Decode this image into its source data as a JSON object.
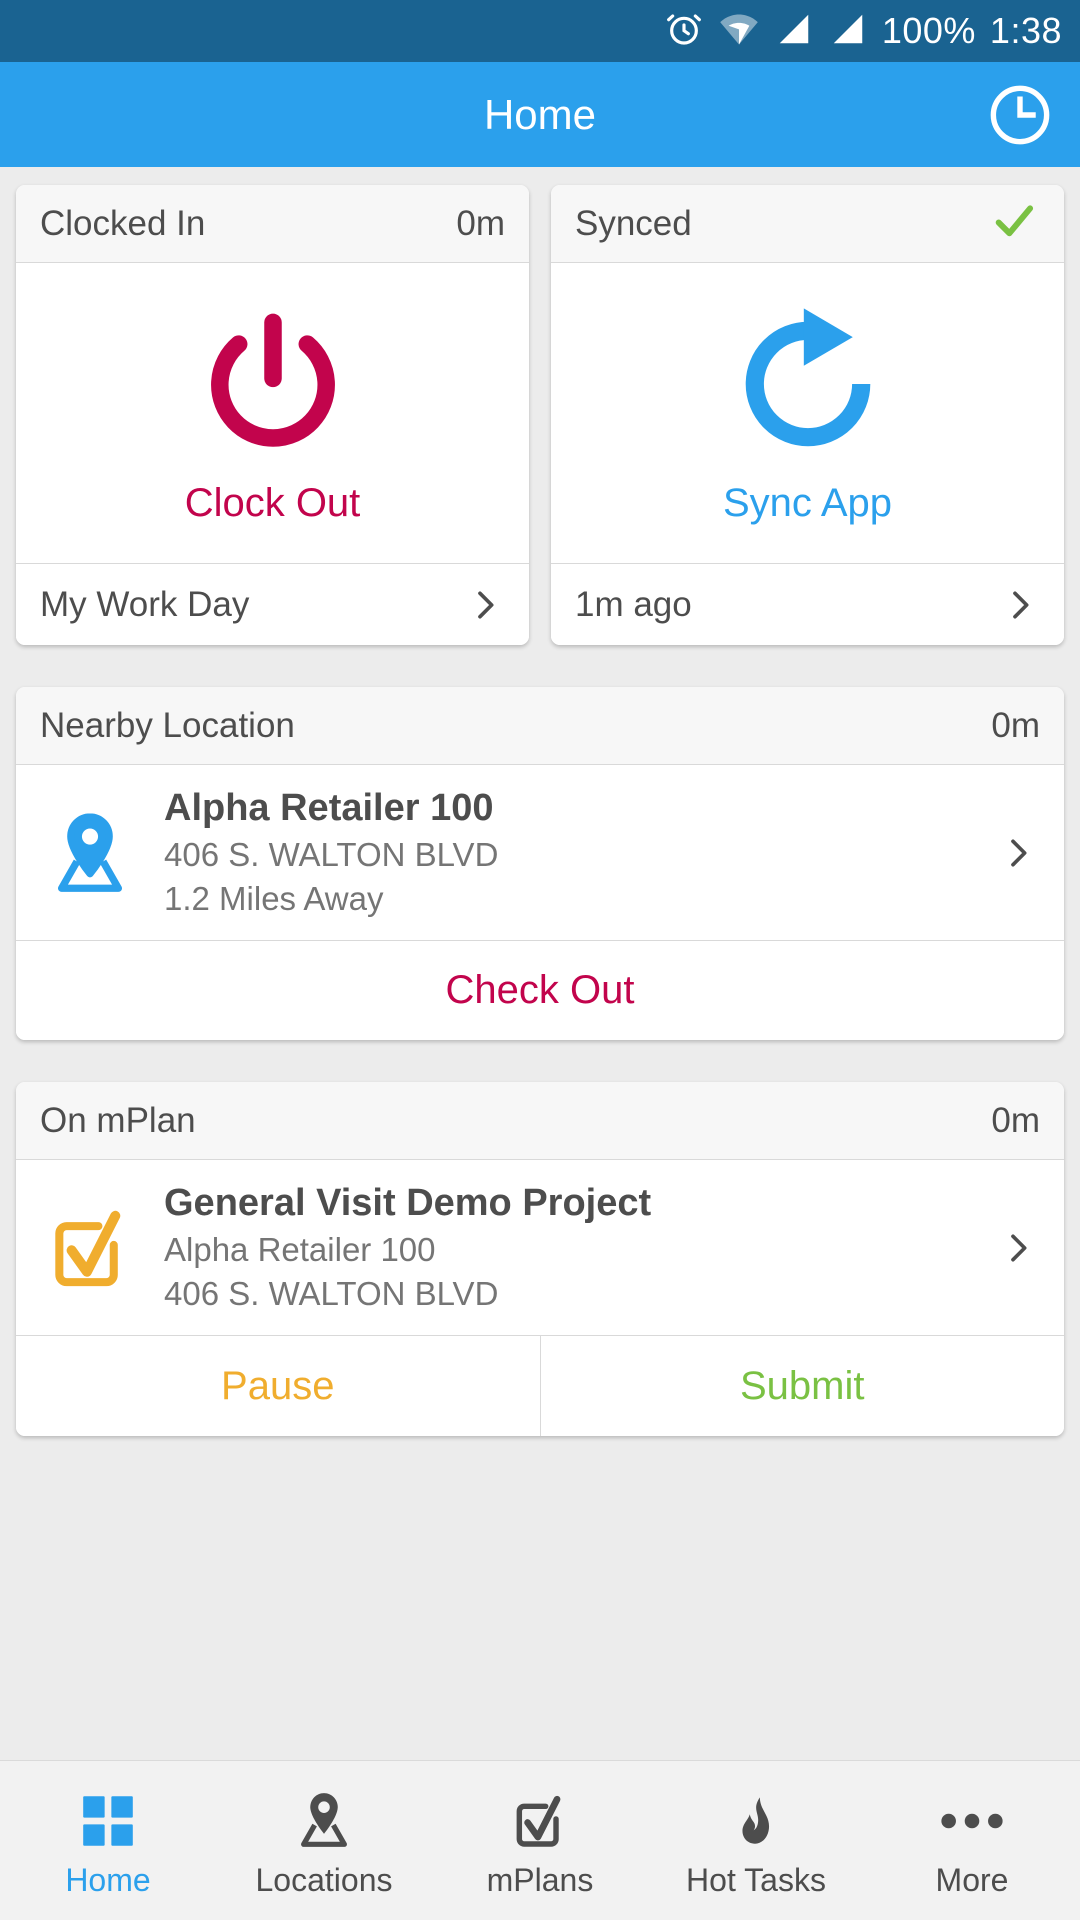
{
  "status_bar": {
    "icons": [
      "alarm-icon",
      "wifi-icon",
      "signal-1-icon",
      "signal-2-icon"
    ],
    "battery_percent": "100%",
    "time": "1:38"
  },
  "app_bar": {
    "title": "Home",
    "action_icon": "clock-icon"
  },
  "colors": {
    "status_bar_bg": "#1a6391",
    "app_bar_bg": "#2ba0ec",
    "accent_blue": "#2ba0ec",
    "crimson": "#c2044c",
    "amber": "#f0ad2e",
    "green": "#7ac143",
    "check_green": "#7ac143",
    "page_bg": "#ececec",
    "card_header_bg": "#f7f7f7",
    "text_primary": "#4d4d4d",
    "text_secondary": "#757575"
  },
  "clock_card": {
    "header_title": "Clocked In",
    "header_value": "0m",
    "action_icon": "power-icon",
    "action_label": "Clock Out",
    "footer_label": "My Work Day",
    "footer_icon": "chevron-right-icon"
  },
  "sync_card": {
    "header_title": "Synced",
    "header_status_icon": "check-icon",
    "action_icon": "refresh-icon",
    "action_label": "Sync App",
    "footer_label": "1m ago",
    "footer_icon": "chevron-right-icon"
  },
  "nearby_location_card": {
    "header_title": "Nearby Location",
    "header_value": "0m",
    "row_icon": "map-pin-icon",
    "name": "Alpha Retailer 100",
    "address": "406 S. WALTON BLVD",
    "distance": "1.2 Miles Away",
    "row_chevron": "chevron-right-icon",
    "action_label": "Check Out"
  },
  "mplan_card": {
    "header_title": "On mPlan",
    "header_value": "0m",
    "row_icon": "checkbox-checked-icon",
    "name": "General Visit Demo Project",
    "retailer": "Alpha Retailer 100",
    "address": "406 S. WALTON BLVD",
    "row_chevron": "chevron-right-icon",
    "pause_label": "Pause",
    "submit_label": "Submit"
  },
  "bottom_nav": {
    "items": [
      {
        "label": "Home",
        "icon": "grid-icon",
        "active": true
      },
      {
        "label": "Locations",
        "icon": "map-pin-icon",
        "active": false
      },
      {
        "label": "mPlans",
        "icon": "checkbox-checked-icon",
        "active": false
      },
      {
        "label": "Hot Tasks",
        "icon": "flame-icon",
        "active": false
      },
      {
        "label": "More",
        "icon": "ellipsis-icon",
        "active": false
      }
    ]
  }
}
